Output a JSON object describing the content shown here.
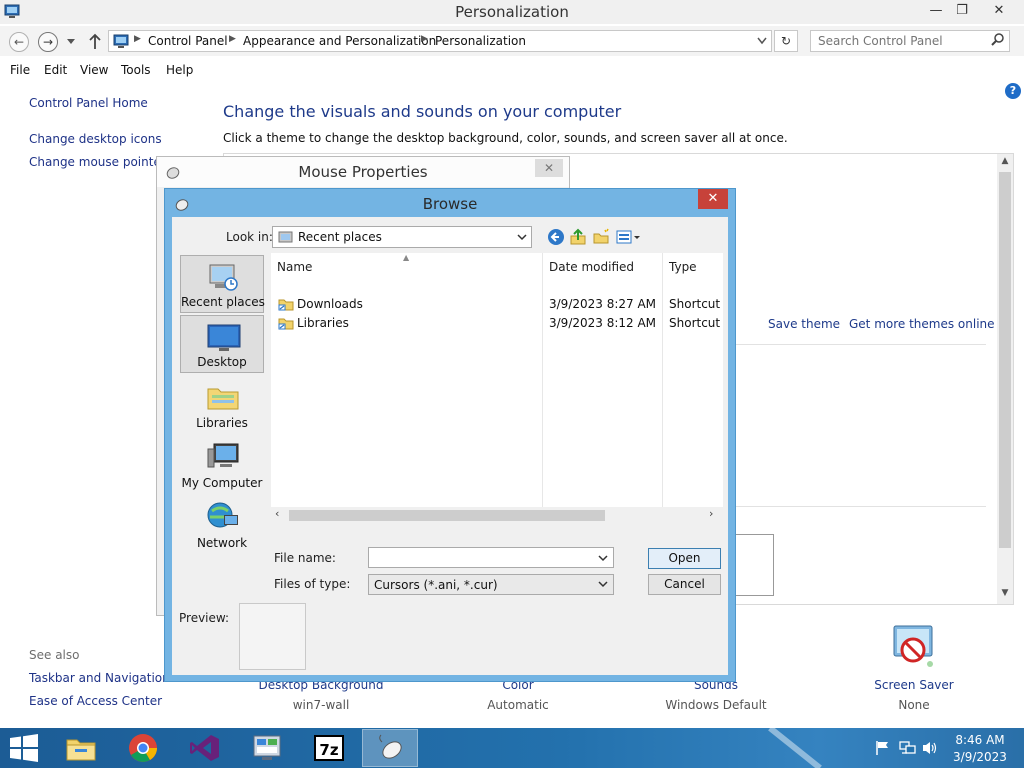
{
  "window": {
    "title": "Personalization",
    "minimize": "—",
    "maximize": "❐",
    "close": "✕"
  },
  "addressbar": {
    "crumbs": [
      "Control Panel",
      "Appearance and Personalization",
      "Personalization"
    ],
    "search_placeholder": "Search Control Panel"
  },
  "menu": [
    "File",
    "Edit",
    "View",
    "Tools",
    "Help"
  ],
  "sidebar": {
    "home": "Control Panel Home",
    "links": [
      "Change desktop icons",
      "Change mouse pointers"
    ],
    "see_also": "See also",
    "see_also_links": [
      "Taskbar and Navigation",
      "Ease of Access Center"
    ]
  },
  "main": {
    "heading": "Change the visuals and sounds on your computer",
    "subtitle": "Click a theme to change the desktop background, color, sounds, and screen saver all at once.",
    "save_theme": "Save theme",
    "more_themes": "Get more themes online",
    "help": "?",
    "bottom_items": [
      {
        "label": "Desktop Background",
        "value": "win7-wall"
      },
      {
        "label": "Color",
        "value": "Automatic"
      },
      {
        "label": "Sounds",
        "value": "Windows Default"
      },
      {
        "label": "Screen Saver",
        "value": "None"
      }
    ]
  },
  "mouse_dialog": {
    "title": "Mouse Properties",
    "close": "✕"
  },
  "browse_dialog": {
    "title": "Browse",
    "close": "✕",
    "look_in_label": "Look in:",
    "look_in_value": "Recent places",
    "places": [
      "Recent places",
      "Desktop",
      "Libraries",
      "My Computer",
      "Network"
    ],
    "columns": [
      "Name",
      "Date modified",
      "Type"
    ],
    "files": [
      {
        "name": "Downloads",
        "date": "3/9/2023 8:27 AM",
        "type": "Shortcut"
      },
      {
        "name": "Libraries",
        "date": "3/9/2023 8:12 AM",
        "type": "Shortcut"
      }
    ],
    "file_name_label": "File name:",
    "file_name_value": "",
    "files_of_type_label": "Files of type:",
    "files_of_type_value": "Cursors (*.ani, *.cur)",
    "open_button": "Open",
    "cancel_button": "Cancel",
    "preview_label": "Preview:"
  },
  "taskbar": {
    "apps": [
      "File Explorer",
      "Google Chrome",
      "Visual Studio",
      "Control Panel",
      "7-Zip",
      "Mouse Properties"
    ],
    "time": "8:46 AM",
    "date": "3/9/2023"
  },
  "colors": {
    "accent_link": "#1e3a8a",
    "dialog_frame": "#73b4e3",
    "close_red": "#c7423a",
    "taskbar": "#2371ad"
  }
}
